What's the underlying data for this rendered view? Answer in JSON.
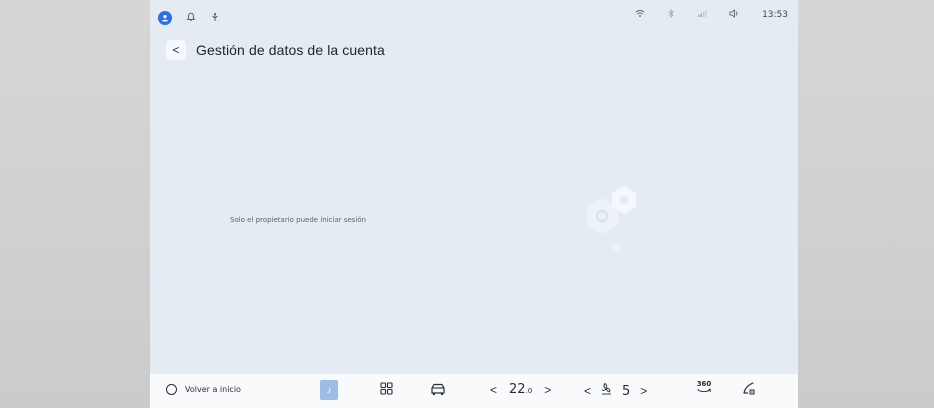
{
  "status_bar": {
    "time": "13:53",
    "icons": [
      "user-icon",
      "bell-icon",
      "navigation-icon",
      "wifi-icon",
      "bluetooth-icon",
      "signal-icon",
      "volume-icon"
    ]
  },
  "header": {
    "back_symbol": "<",
    "title": "Gestión de datos de la cuenta"
  },
  "main": {
    "message": "Solo el propietario puede iniciar sesión"
  },
  "bottom_bar": {
    "home_label": "Volver a inicio",
    "music_symbol": "♪",
    "temp_left_chevron": "<",
    "temperature": "22",
    "temperature_unit": ".0",
    "temp_right_chevron": ">",
    "fan_left_chevron": "<",
    "fan_level": "5",
    "fan_right_chevron": ">",
    "view_360_label": "360"
  },
  "colors": {
    "screen_bg": "#e4ebf3",
    "accent": "#2f6fe3",
    "bottom_bar_bg": "#f8fafc"
  }
}
